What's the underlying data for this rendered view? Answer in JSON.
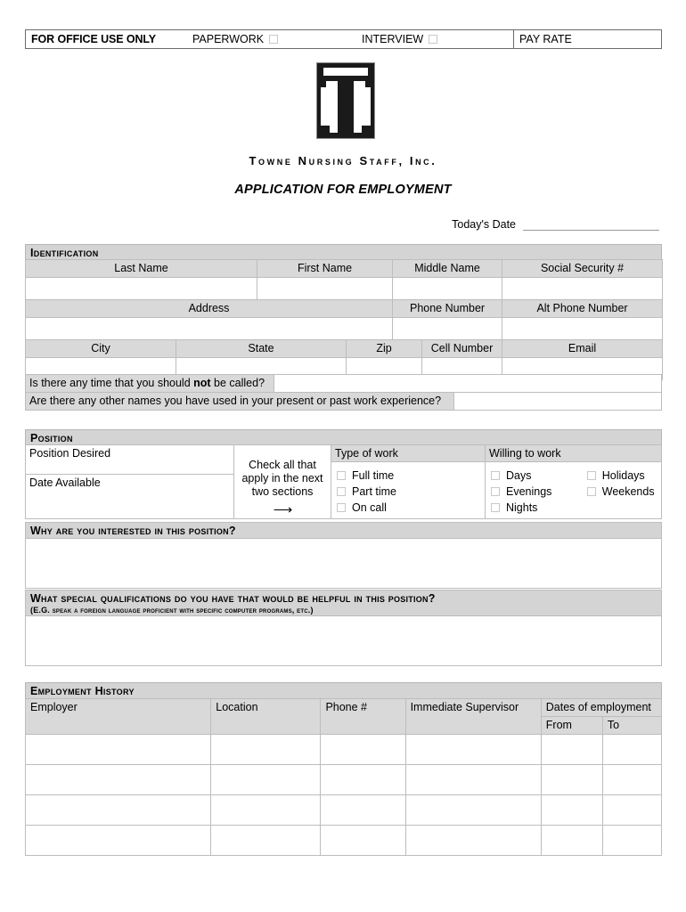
{
  "office_use": {
    "title": "FOR OFFICE USE ONLY",
    "paperwork_label": "PAPERWORK",
    "interview_label": "INTERVIEW",
    "pay_rate_label": "PAY RATE"
  },
  "header": {
    "company_name": "Towne Nursing Staff, Inc.",
    "form_title": "APPLICATION FOR EMPLOYMENT",
    "todays_date_label": "Today's Date",
    "todays_date_value": ""
  },
  "identification": {
    "section_title": "Identification",
    "row1_headers": [
      "Last Name",
      "First Name",
      "Middle Name",
      "Social Security #"
    ],
    "row1_values": [
      "",
      "",
      "",
      ""
    ],
    "row2_headers": [
      "Address",
      "Phone Number",
      "Alt Phone Number"
    ],
    "row2_values": [
      "",
      "",
      ""
    ],
    "row3_headers": [
      "City",
      "State",
      "Zip",
      "Cell Number",
      "Email"
    ],
    "row3_values": [
      "",
      "",
      "",
      "",
      ""
    ]
  },
  "questions": {
    "q1_part1": "Is there any time that you should ",
    "q1_bold": "not",
    "q1_part2": " be called?",
    "q1_answer": "",
    "q2": "Are there any other names you have used in your present or past work experience?",
    "q2_answer": ""
  },
  "position": {
    "section_title": "Position",
    "position_desired_label": "Position Desired",
    "position_desired_value": "",
    "date_available_label": "Date Available",
    "date_available_value": "",
    "check_note": "Check all that apply in the next two sections",
    "arrow_glyph": "⟶",
    "type_of_work_header": "Type of work",
    "type_of_work_options": [
      "Full time",
      "Part time",
      "On call"
    ],
    "willing_to_work_header": "Willing to work",
    "willing_to_work_col1": [
      "Days",
      "Evenings",
      "Nights"
    ],
    "willing_to_work_col2": [
      "Holidays",
      "Weekends"
    ]
  },
  "why_interested": {
    "heading": "Why are you interested in this position?",
    "answer": ""
  },
  "qualifications": {
    "heading": "What special qualifications do you have that would be helpful in this position?",
    "subheading": "(E.G. speak a foreign language proficient with specific computer programs, etc.)",
    "answer": ""
  },
  "employment_history": {
    "section_title": "Employment History",
    "headers": [
      "Employer",
      "Location",
      "Phone #",
      "Immediate Supervisor"
    ],
    "dates_group_header": "Dates of employment",
    "dates_sub_headers": [
      "From",
      "To"
    ],
    "rows": [
      [
        "",
        "",
        "",
        "",
        "",
        ""
      ],
      [
        "",
        "",
        "",
        "",
        "",
        ""
      ],
      [
        "",
        "",
        "",
        "",
        "",
        ""
      ],
      [
        "",
        "",
        "",
        "",
        "",
        ""
      ]
    ]
  }
}
